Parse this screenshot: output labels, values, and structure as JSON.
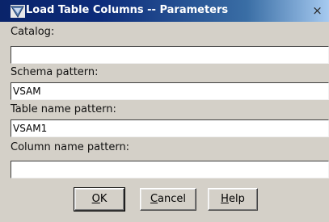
{
  "window": {
    "title": "Load Table Columns -- Parameters",
    "close_glyph": "×"
  },
  "fields": {
    "catalog": {
      "label": "Catalog:",
      "value": ""
    },
    "schema": {
      "label": "Schema pattern:",
      "value": "VSAM"
    },
    "table": {
      "label": "Table name pattern:",
      "value": "VSAM1"
    },
    "column": {
      "label": "Column name pattern:",
      "value": ""
    }
  },
  "buttons": {
    "ok": {
      "mnemonic": "O",
      "rest": "K"
    },
    "cancel": {
      "mnemonic": "C",
      "rest": "ancel"
    },
    "help": {
      "mnemonic": "H",
      "rest": "elp"
    }
  },
  "icons": {
    "app": "dialog-app-icon",
    "close": "close-icon"
  }
}
